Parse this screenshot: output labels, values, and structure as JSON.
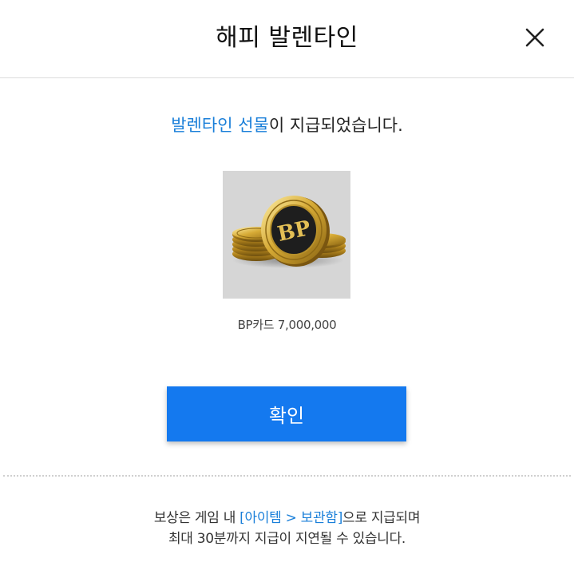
{
  "header": {
    "title": "해피 발렌타인",
    "close_icon": "close-icon"
  },
  "message": {
    "highlight": "발렌타인 선물",
    "rest": "이 지급되었습니다."
  },
  "reward": {
    "image_icon": "bp-coin-stack-icon",
    "coin_text": "BP",
    "label": "BP카드 7,000,000"
  },
  "confirm": {
    "label": "확인"
  },
  "notice": {
    "line1_prefix": "보상은 게임 내 ",
    "line1_link": "[아이템 > 보관함]",
    "line1_suffix": "으로 지급되며",
    "line2": "최대 30분까지 지급이 지연될 수 있습니다."
  },
  "colors": {
    "accent": "#1479ef",
    "highlight_text": "#1a7fd9",
    "image_bg": "#d6d6d6",
    "coin_gold": "#c9a22e",
    "coin_center": "#1e1e1e"
  }
}
